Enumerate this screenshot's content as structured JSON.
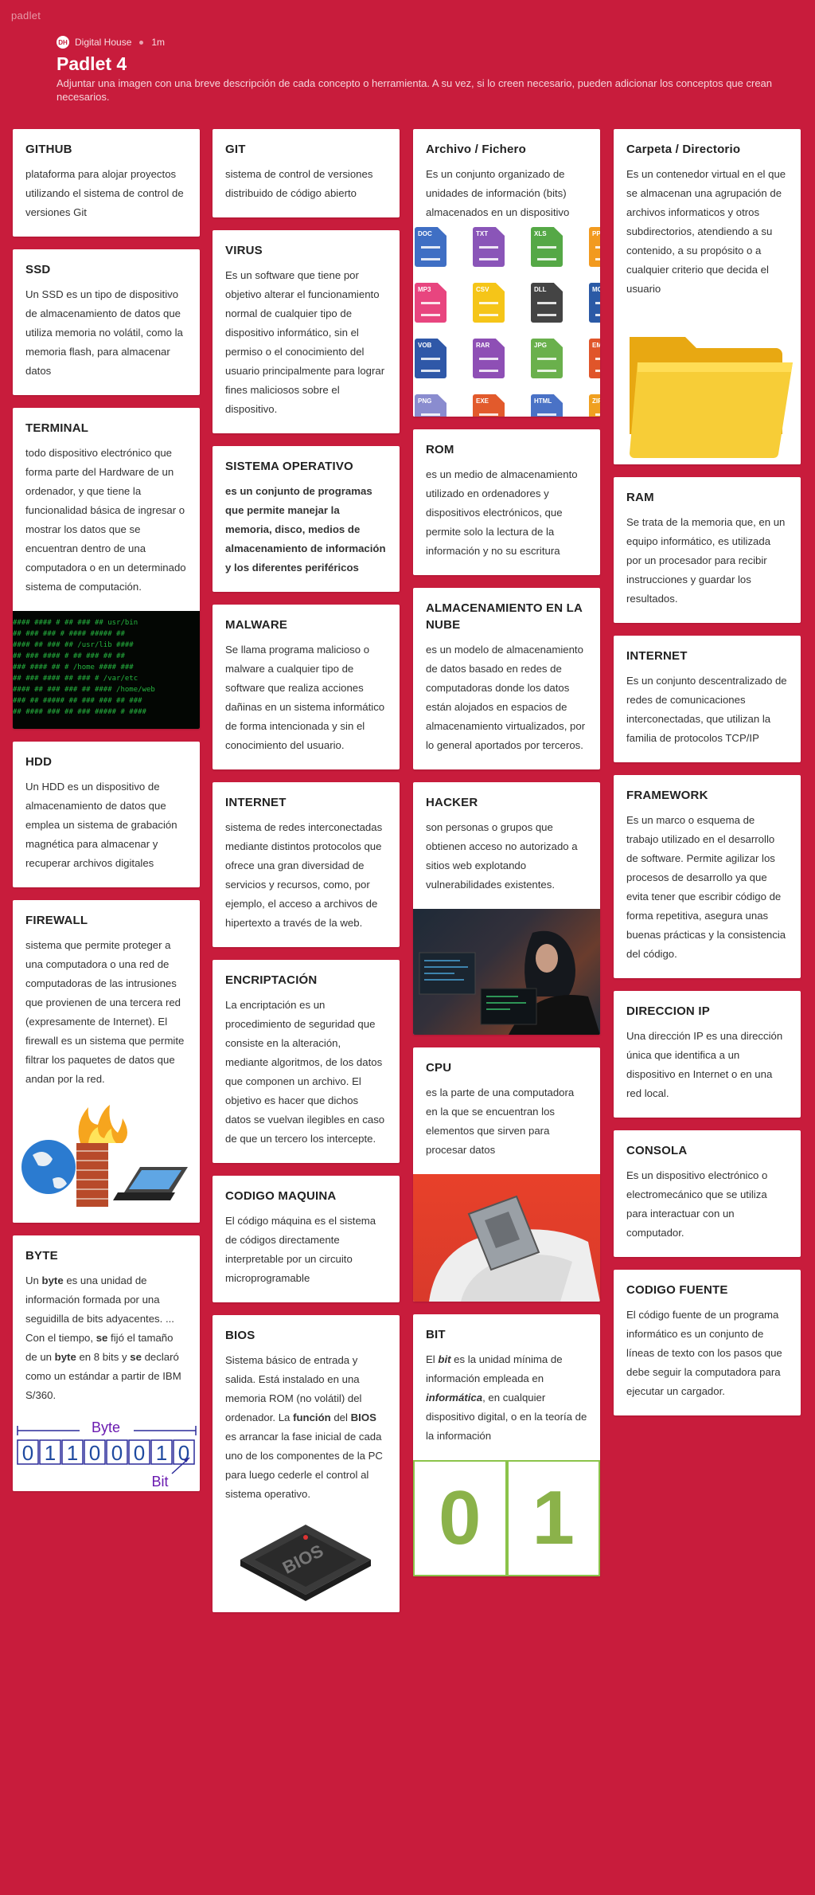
{
  "app": {
    "brand": "padlet"
  },
  "header": {
    "avatar": "DH",
    "author": "Digital House",
    "time": "1m",
    "title": "Padlet 4",
    "description": "Adjuntar una imagen con una breve descripción de cada concepto o herramienta. A su vez, si lo creen necesario, pueden adicionar los conceptos que crean necesarios."
  },
  "cards": {
    "github": {
      "title": "GITHUB",
      "body": "plataforma para alojar proyectos utilizando el sistema de control de versiones Git"
    },
    "ssd": {
      "title": "SSD",
      "body": "Un SSD es un tipo de dispositivo de almacenamiento de datos que utiliza memoria no volátil, como la memoria flash, para almacenar datos"
    },
    "terminal": {
      "title": "TERMINAL",
      "body": " todo dispositivo electrónico que forma parte del Hardware de un ordenador, y que tiene la funcionalidad básica de ingresar o mostrar los datos que se encuentran dentro de una computadora o en un determinado sistema de computación."
    },
    "hdd": {
      "title": "HDD",
      "body": "Un HDD es un dispositivo de almacenamiento de datos que emplea un sistema de grabación magnética para almacenar y recuperar archivos digitales"
    },
    "firewall": {
      "title": "FIREWALL",
      "body": "sistema que permite proteger a una computadora o una red de computadoras de las intrusiones que provienen de una tercera red (expresamente de Internet). El firewall es un sistema que permite filtrar los paquetes de datos que andan por la red."
    },
    "byte": {
      "title": "BYTE",
      "p1": "Un ",
      "b1": "byte",
      "p2": " es una unidad de información formada por una seguidilla de bits adyacentes. ... Con el tiempo, ",
      "b2": "se",
      "p3": " fijó el tamaño de un ",
      "b3": "byte",
      "p4": " en 8 bits y ",
      "b4": "se",
      "p5": " declaró como un estándar a partir de IBM S/360.",
      "img_label_top": "Byte",
      "img_bits": "01100010",
      "img_label_bottom": "Bit"
    },
    "git": {
      "title": "GIT",
      "body": "sistema de control de versiones distribuido de código abierto"
    },
    "virus": {
      "title": "VIRUS",
      "body": "Es un software que tiene por objetivo alterar el funcionamiento normal de cualquier tipo de dispositivo informático, sin el permiso o el conocimiento del usuario principalmente para lograr fines maliciosos sobre el dispositivo."
    },
    "so": {
      "title": "SISTEMA OPERATIVO",
      "body": "es un conjunto de programas que permite manejar la memoria, disco, medios de almacenamiento de información y los diferentes periféricos"
    },
    "malware": {
      "title": "MALWARE",
      "body": "Se llama programa malicioso o malware a cualquier tipo de software que realiza acciones dañinas en un sistema informático de forma intencionada y sin el conocimiento del usuario."
    },
    "internet1": {
      "title": "INTERNET",
      "body": "sistema de redes interconectadas mediante distintos protocolos que ofrece una gran diversidad de servicios y recursos, como, por ejemplo, el acceso a archivos de hipertexto a través de la web."
    },
    "encriptacion": {
      "title": "ENCRIPTACIÓN",
      "body": "La encriptación es un procedimiento de seguridad que consiste en la alteración, mediante algoritmos, de los datos que componen un archivo. El objetivo es hacer que dichos datos se vuelvan ilegibles en caso de que un tercero los intercepte."
    },
    "codigo_maquina": {
      "title": "CODIGO MAQUINA",
      "body": "El código máquina es el sistema de códigos directamente interpretable por un circuito microprogramable"
    },
    "bios": {
      "title": "BIOS",
      "p1": "Sistema básico de entrada y salida. Está instalado en una memoria ROM (no volátil) del ordenador. La ",
      "b1": "función",
      "p2": " del ",
      "b2": "BIOS",
      "p3": " es arrancar la fase inicial de cada uno de los componentes de la PC para luego cederle el control al sistema operativo.",
      "img_label": "BIOS"
    },
    "archivo": {
      "title": "Archivo / Fichero",
      "body": "Es un conjunto organizado de unidades de información (bits) almacenados en un dispositivo"
    },
    "rom": {
      "title": "ROM",
      "body": "es un medio de almacenamiento utilizado en ordenadores y dispositivos electrónicos, que permite solo la lectura de la información y no su escritura"
    },
    "nube": {
      "title": "ALMACENAMIENTO EN LA NUBE",
      "body": "es un modelo de almacenamiento de datos basado en redes de computadoras donde los datos están alojados en espacios de almacenamiento virtualizados, por lo general aportados por terceros."
    },
    "hacker": {
      "title": "HACKER",
      "body": "son personas o grupos que obtienen acceso no autorizado a sitios web explotando vulnerabilidades existentes."
    },
    "cpu": {
      "title": "CPU",
      "body": "es la parte de una computadora en la que se encuentran los elementos que sirven para procesar datos"
    },
    "bit": {
      "title": "BIT",
      "p1": "El ",
      "b1": "bit",
      "p2": " es la unidad mínima de información empleada en ",
      "b2": "informática",
      "p3": ", en cualquier dispositivo digital, o en la teoría de la información",
      "img_zero": "0",
      "img_one": "1"
    },
    "carpeta": {
      "title": "Carpeta / Directorio",
      "body": "Es un contenedor virtual en el que se almacenan una agrupación de archivos informaticos y otros subdirectorios, atendiendo a su contenido, a su propósito o a cualquier criterio que decida el usuario"
    },
    "ram": {
      "title": "RAM",
      "body": "Se trata de la memoria que, en un equipo informático, es utilizada por un procesador para recibir instrucciones y guardar los resultados."
    },
    "internet2": {
      "title": "INTERNET",
      "body": "Es un conjunto descentralizado de redes de comunicaciones interconectadas, que utilizan la familia de protocolos TCP/IP"
    },
    "framework": {
      "title": "FRAMEWORK",
      "body": "Es un marco o esquema de trabajo utilizado en el desarrollo de software. Permite agilizar los procesos de desarrollo ya que evita tener que escribir código de forma repetitiva, asegura unas buenas prácticas y la consistencia del código."
    },
    "ip": {
      "title": "DIRECCION IP",
      "body": "Una dirección IP es una dirección única que identifica a un dispositivo en Internet o en una red local."
    },
    "consola": {
      "title": "CONSOLA",
      "body": "Es un dispositivo electrónico o electromecánico que se utiliza para interactuar con un computador."
    },
    "codigo_fuente": {
      "title": "CODIGO FUENTE",
      "body": "El código fuente de un programa informático es un conjunto de líneas de texto con los pasos que debe seguir la computadora para ejecutar un cargador."
    }
  },
  "file_icons": [
    "DOC",
    "TXT",
    "XLS",
    "PPT",
    "MP3",
    "CSV",
    "DLL",
    "MOV",
    "VOB",
    "RAR",
    "JPG",
    "EML",
    "PNG",
    "EXE",
    "HTML",
    "ZIP"
  ],
  "file_colors": [
    "#3f6fc4",
    "#8a55b8",
    "#55a846",
    "#f29a1f",
    "#e8457f",
    "#f5c518",
    "#444",
    "#2b5aa6",
    "#2f58a8",
    "#8e4fb5",
    "#6ab04c",
    "#e0552a",
    "#8a8ccf",
    "#e25a2c",
    "#4a72c6",
    "#f0a020"
  ]
}
